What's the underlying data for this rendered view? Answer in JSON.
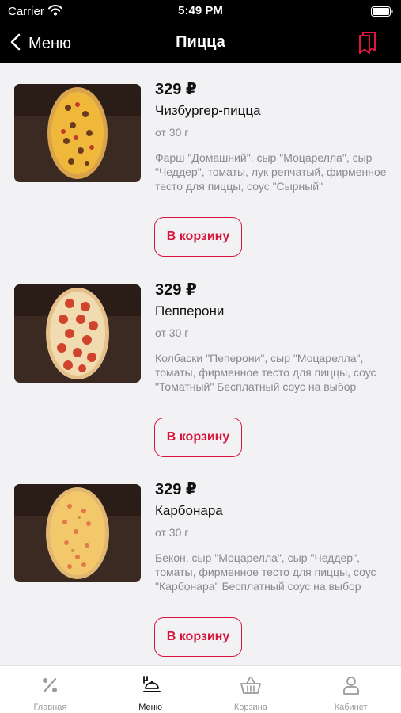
{
  "status_bar": {
    "carrier": "Carrier",
    "time": "5:49 PM"
  },
  "nav": {
    "back_label": "Меню",
    "title": "Пицца"
  },
  "accent_color": "#d6163e",
  "products": [
    {
      "price": "329 ₽",
      "name": "Чизбургер-пицца",
      "weight": "от 30 г",
      "description": "Фарш \"Домашний\", сыр \"Моцарелла\", сыр \"Чеддер\", томаты, лук репчатый, фирменное тесто для пиццы, соус \"Сырный\"",
      "button": "В корзину"
    },
    {
      "price": "329 ₽",
      "name": "Пепперони",
      "weight": "от 30 г",
      "description": "Колбаски \"Пеперони\", сыр \"Моцарелла\", томаты, фирменное тесто для пиццы, соус \"Томатный\" Бесплатный соус на выбор",
      "button": "В корзину"
    },
    {
      "price": "329 ₽",
      "name": "Карбонара",
      "weight": "от 30 г",
      "description": "Бекон, сыр \"Моцарелла\", сыр \"Чеддер\", томаты, фирменное тесто для пиццы, соус \"Карбонара\" Бесплатный соус на выбор",
      "button": "В корзину"
    }
  ],
  "tabs": [
    {
      "label": "Главная",
      "icon": "percent-icon",
      "active": false
    },
    {
      "label": "Меню",
      "icon": "menu-cloche-icon",
      "active": true
    },
    {
      "label": "Корзина",
      "icon": "basket-icon",
      "active": false
    },
    {
      "label": "Кабинет",
      "icon": "profile-icon",
      "active": false
    }
  ]
}
